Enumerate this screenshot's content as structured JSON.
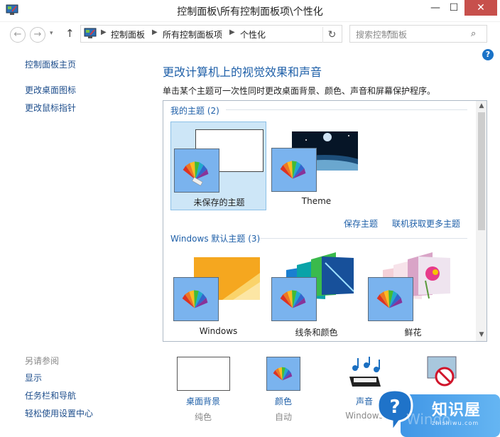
{
  "window": {
    "title": "控制面板\\所有控制面板项\\个性化",
    "minimize": "—",
    "maximize": "☐",
    "close": "✕"
  },
  "nav": {
    "back": "←",
    "forward": "→",
    "dropdown": "▾",
    "up": "↑",
    "refresh": "↻"
  },
  "breadcrumb": [
    "控制面板",
    "所有控制面板项",
    "个性化"
  ],
  "search": {
    "placeholder": "搜索控制面板",
    "icon": "⌕"
  },
  "help": "?",
  "sidebar": {
    "links": [
      "控制面板主页",
      "更改桌面图标",
      "更改鼠标指针"
    ],
    "see_also_title": "另请参阅",
    "see_also": [
      "显示",
      "任务栏和导航",
      "轻松使用设置中心"
    ]
  },
  "main": {
    "heading": "更改计算机上的视觉效果和声音",
    "description": "单击某个主题可一次性同时更改桌面背景、颜色、声音和屏幕保护程序。"
  },
  "my_themes": {
    "title": "我的主题 (2)",
    "items": [
      {
        "label": "未保存的主题",
        "selected": true
      },
      {
        "label": "Theme",
        "selected": false
      }
    ],
    "save_link": "保存主题",
    "online_link": "联机获取更多主题"
  },
  "default_themes": {
    "title": "Windows 默认主题 (3)",
    "items": [
      {
        "label": "Windows"
      },
      {
        "label": "线条和颜色"
      },
      {
        "label": "鲜花"
      }
    ]
  },
  "bottom": [
    {
      "label": "桌面背景",
      "sub": "纯色"
    },
    {
      "label": "颜色",
      "sub": "自动"
    },
    {
      "label": "声音",
      "sub": "Windows"
    }
  ],
  "watermark": {
    "text": "知识屋",
    "sub": "zhishiwu.com",
    "bg_text": "Windo"
  },
  "colors": {
    "link": "#1e5fa8",
    "selected_tile": "#cde6f7",
    "close": "#c7504c"
  }
}
